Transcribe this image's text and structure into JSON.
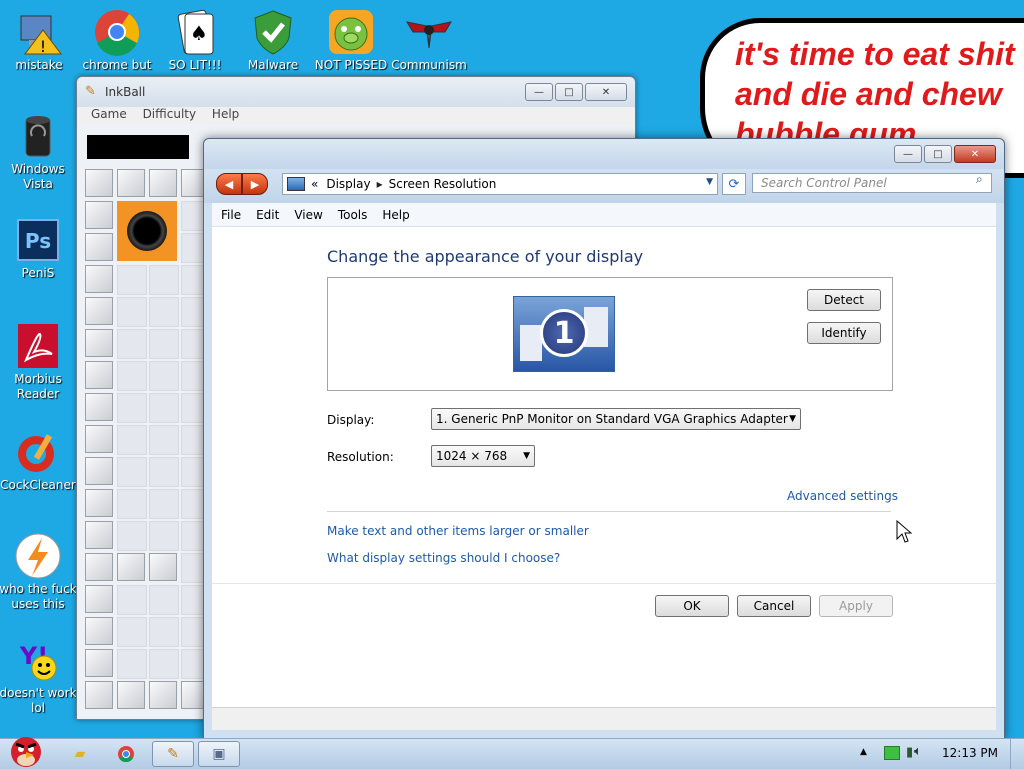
{
  "desktop": {
    "icons": [
      {
        "label": "mistake",
        "icon": "computer-warning-icon"
      },
      {
        "label": "chrome but",
        "icon": "chrome-icon"
      },
      {
        "label": "SO LIT!!!",
        "icon": "solitaire-icon"
      },
      {
        "label": "Malware",
        "icon": "shield-check-icon"
      },
      {
        "label": "NOT PISSED",
        "icon": "green-pig-icon"
      },
      {
        "label": "Communism",
        "icon": "emblem-icon"
      },
      {
        "label": "Windows Vista",
        "icon": "recycle-bin-icon"
      },
      {
        "label": "PeniS",
        "icon": "photoshop-icon"
      },
      {
        "label": "Morbius Reader",
        "icon": "acrobat-icon"
      },
      {
        "label": "CockCleaner",
        "icon": "ccleaner-icon"
      },
      {
        "label": "who the fuck uses this",
        "icon": "winamp-icon"
      },
      {
        "label": "doesn't work lol",
        "icon": "yahoo-messenger-icon"
      }
    ],
    "bubble_text": "it's time to eat shit\nand die and chew\nbubble gum"
  },
  "inkball": {
    "title": "InkBall",
    "menu": [
      "Game",
      "Difficulty",
      "Help"
    ]
  },
  "control_panel": {
    "breadcrumb_prefix": "«",
    "breadcrumb": [
      "Display",
      "Screen Resolution"
    ],
    "search_placeholder": "Search Control Panel",
    "menu": [
      "File",
      "Edit",
      "View",
      "Tools",
      "Help"
    ],
    "heading": "Change the appearance of your display",
    "monitor_number": "1",
    "detect_label": "Detect",
    "identify_label": "Identify",
    "display_label": "Display:",
    "display_value": "1. Generic PnP Monitor on Standard VGA Graphics Adapter",
    "resolution_label": "Resolution:",
    "resolution_value": "1024 × 768",
    "advanced_settings": "Advanced settings",
    "link_text_size": "Make text and other items larger or smaller",
    "link_help": "What display settings should I choose?",
    "ok_label": "OK",
    "cancel_label": "Cancel",
    "apply_label": "Apply"
  },
  "taskbar": {
    "clock": "12:13 PM"
  },
  "colors": {
    "desktop": "#1ea9e4",
    "link": "#1e5aa8",
    "heading": "#1e3a6e",
    "bubble_text": "#e01a1a"
  }
}
